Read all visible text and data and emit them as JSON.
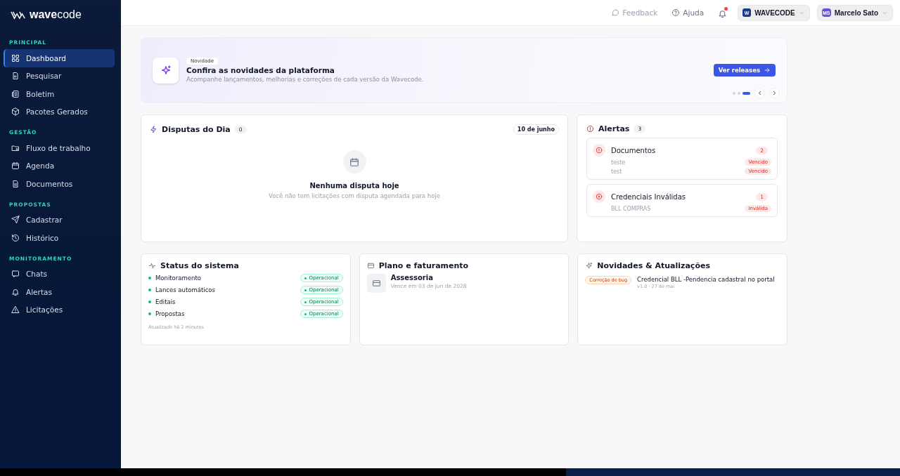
{
  "brand": {
    "logo_bold": "wave",
    "logo_light": "code"
  },
  "sidebar": {
    "sections": [
      {
        "title": "PRINCIPAL",
        "items": [
          {
            "label": "Dashboard",
            "selected": true
          },
          {
            "label": "Pesquisar",
            "selected": false
          },
          {
            "label": "Boletim",
            "selected": false
          },
          {
            "label": "Pacotes Gerados",
            "selected": false
          }
        ]
      },
      {
        "title": "GESTÃO",
        "items": [
          {
            "label": "Fluxo de trabalho",
            "selected": false
          },
          {
            "label": "Agenda",
            "selected": false
          },
          {
            "label": "Documentos",
            "selected": false
          }
        ]
      },
      {
        "title": "PROPOSTAS",
        "items": [
          {
            "label": "Cadastrar",
            "selected": false
          },
          {
            "label": "Histórico",
            "selected": false
          }
        ]
      },
      {
        "title": "MONITORAMENTO",
        "items": [
          {
            "label": "Chats",
            "selected": false
          },
          {
            "label": "Alertas",
            "selected": false
          },
          {
            "label": "Licitações",
            "selected": false
          }
        ]
      }
    ]
  },
  "topbar": {
    "feedback": "Feedback",
    "help": "Ajuda",
    "notifications_unread": true,
    "workspace": {
      "initial": "W",
      "name": "WAVECODE"
    },
    "user": {
      "initials": "MS",
      "name": "Marcelo Sato"
    }
  },
  "banner": {
    "tag": "Novidade",
    "title": "Confira as novidades da plataforma",
    "subtitle": "Acompanhe lançamentos, melhorias e correções de cada versão da Wavecode.",
    "button": "Ver releases",
    "dots": [
      {
        "selected": false
      },
      {
        "selected": false
      },
      {
        "selected": true
      }
    ]
  },
  "disputes": {
    "title": "Disputas do Dia",
    "count": "0",
    "date": "10 de junho",
    "empty_title": "Nenhuma disputa hoje",
    "empty_text": "Você não tem licitações com disputa agendada para hoje"
  },
  "alerts": {
    "title": "Alertas",
    "count": "3",
    "groups": [
      {
        "kind": "warning",
        "title": "Documentos",
        "count": "2",
        "rows": [
          {
            "name": "teste",
            "status": "Vencido"
          },
          {
            "name": "test",
            "status": "Vencido"
          }
        ]
      },
      {
        "kind": "error",
        "title": "Credenciais Inválidas",
        "count": "1",
        "rows": [
          {
            "name": "BLL COMPRAS",
            "status": "Inválida"
          }
        ]
      }
    ]
  },
  "system_status": {
    "title": "Status do sistema",
    "services": [
      {
        "name": "Monitoramento",
        "status": "Operacional",
        "color": "#10b981"
      },
      {
        "name": "Lances automáticos",
        "status": "Operacional",
        "color": "#10b981"
      },
      {
        "name": "Editais",
        "status": "Operacional",
        "color": "#10b981"
      },
      {
        "name": "Propostas",
        "status": "Operacional",
        "color": "#10b981"
      }
    ],
    "updated": "Atualizado há 2 minutos"
  },
  "plan": {
    "title": "Plano e faturamento",
    "name": "Assessoria",
    "expiry": "Vence em 03 de jun de 2028"
  },
  "updates": {
    "title": "Novidades & Atualizações",
    "items": [
      {
        "tag": "Correção de bug",
        "title": "Credencial BLL -Pendencia cadastral no portal",
        "meta": "v1.0 · 27 de mai"
      }
    ]
  }
}
